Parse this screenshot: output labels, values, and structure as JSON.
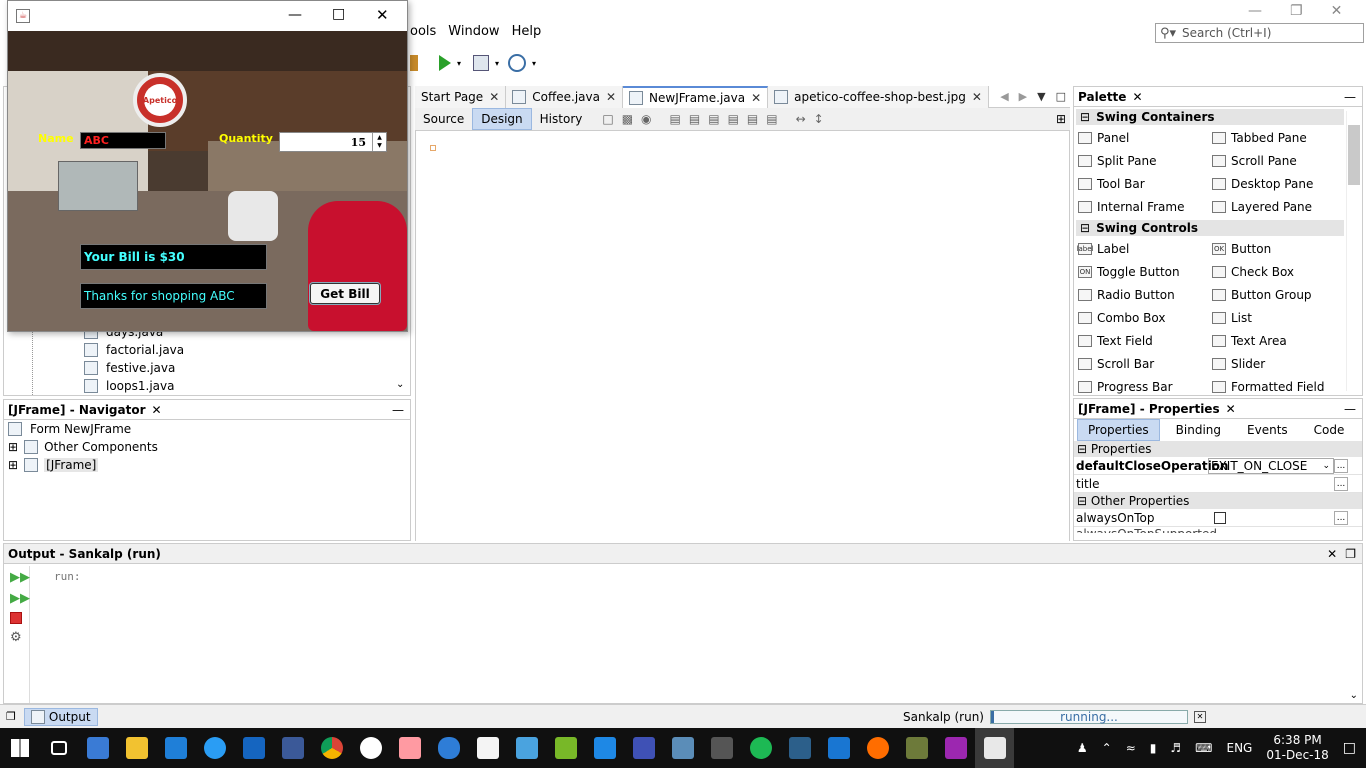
{
  "menu": {
    "items": [
      "ools",
      "Window",
      "Help"
    ]
  },
  "search": {
    "placeholder": "Search (Ctrl+I)"
  },
  "editor": {
    "tabs": [
      {
        "label": "Start Page"
      },
      {
        "label": "Coffee.java"
      },
      {
        "label": "NewJFrame.java"
      },
      {
        "label": "apetico-coffee-shop-best.jpg"
      }
    ],
    "subtabs": [
      "Source",
      "Design",
      "History"
    ]
  },
  "palette": {
    "title": "Palette",
    "containers_label": "Swing Containers",
    "containers": [
      "Panel",
      "Tabbed Pane",
      "Split Pane",
      "Scroll Pane",
      "Tool Bar",
      "Desktop Pane",
      "Internal Frame",
      "Layered Pane"
    ],
    "controls_label": "Swing Controls",
    "controls": [
      "Label",
      "Button",
      "Toggle Button",
      "Check Box",
      "Radio Button",
      "Button Group",
      "Combo Box",
      "List",
      "Text Field",
      "Text Area",
      "Scroll Bar",
      "Slider",
      "Progress Bar",
      "Formatted Field"
    ],
    "icon_glyphs": {
      "Label": "label",
      "Button": "OK",
      "Toggle Button": "ON"
    }
  },
  "properties": {
    "title": "[JFrame] - Properties",
    "tabs": [
      "Properties",
      "Binding",
      "Events",
      "Code"
    ],
    "group1": "Properties",
    "defaultClose_name": "defaultCloseOperation",
    "defaultClose_value": "EXIT_ON_CLOSE",
    "title_name": "title",
    "group2": "Other Properties",
    "alwaysOnTop_name": "alwaysOnTop",
    "cut_row": "alwaysOnTopSupported"
  },
  "project": {
    "files": [
      "days.java",
      "factorial.java",
      "festive.java",
      "loops1.java"
    ]
  },
  "navigator": {
    "title": "[JFrame] - Navigator",
    "form": "Form NewJFrame",
    "other": "Other Components",
    "jframe": "[JFrame]"
  },
  "output": {
    "title": "Output - Sankalp (run)",
    "text": "run:",
    "tab_label": "Output"
  },
  "status": {
    "project": "Sankalp (run)",
    "progress": "running..."
  },
  "taskbar": {
    "lang": "ENG",
    "time": "6:38 PM",
    "date": "01-Dec-18"
  },
  "app": {
    "name_label": "Name",
    "name_value": "ABC",
    "quantity_label": "Quantity",
    "quantity_value": "15",
    "bill_text": "Your Bill is $30",
    "thanks_text": "Thanks for shopping ABC",
    "get_bill": "Get Bill",
    "logo_text": "Apetico"
  },
  "colors": {
    "label_yellow": "#ffff00",
    "name_red": "#ff2020",
    "field_cyan": "#44ffff",
    "progress_blue": "#3a6ea5",
    "taskbar_bg": "#101010"
  }
}
